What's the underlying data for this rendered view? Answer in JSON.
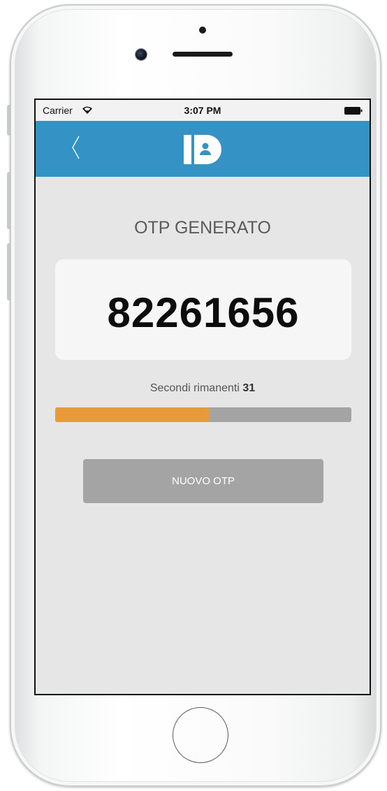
{
  "status_bar": {
    "carrier": "Carrier",
    "time": "3:07 PM"
  },
  "nav": {
    "logo_text": "ID",
    "color": "#3493c4"
  },
  "main": {
    "title": "OTP GENERATO",
    "otp_code": "82261656",
    "remaining_label": "Secondi rimanenti",
    "remaining_seconds": "31",
    "progress_fraction": 0.52,
    "progress_color": "#e99a38",
    "new_otp_label": "NUOVO OTP"
  },
  "icons": {
    "back": "chevron-left-icon",
    "wifi": "wifi-icon",
    "battery": "battery-icon",
    "logo": "id-logo-icon"
  }
}
